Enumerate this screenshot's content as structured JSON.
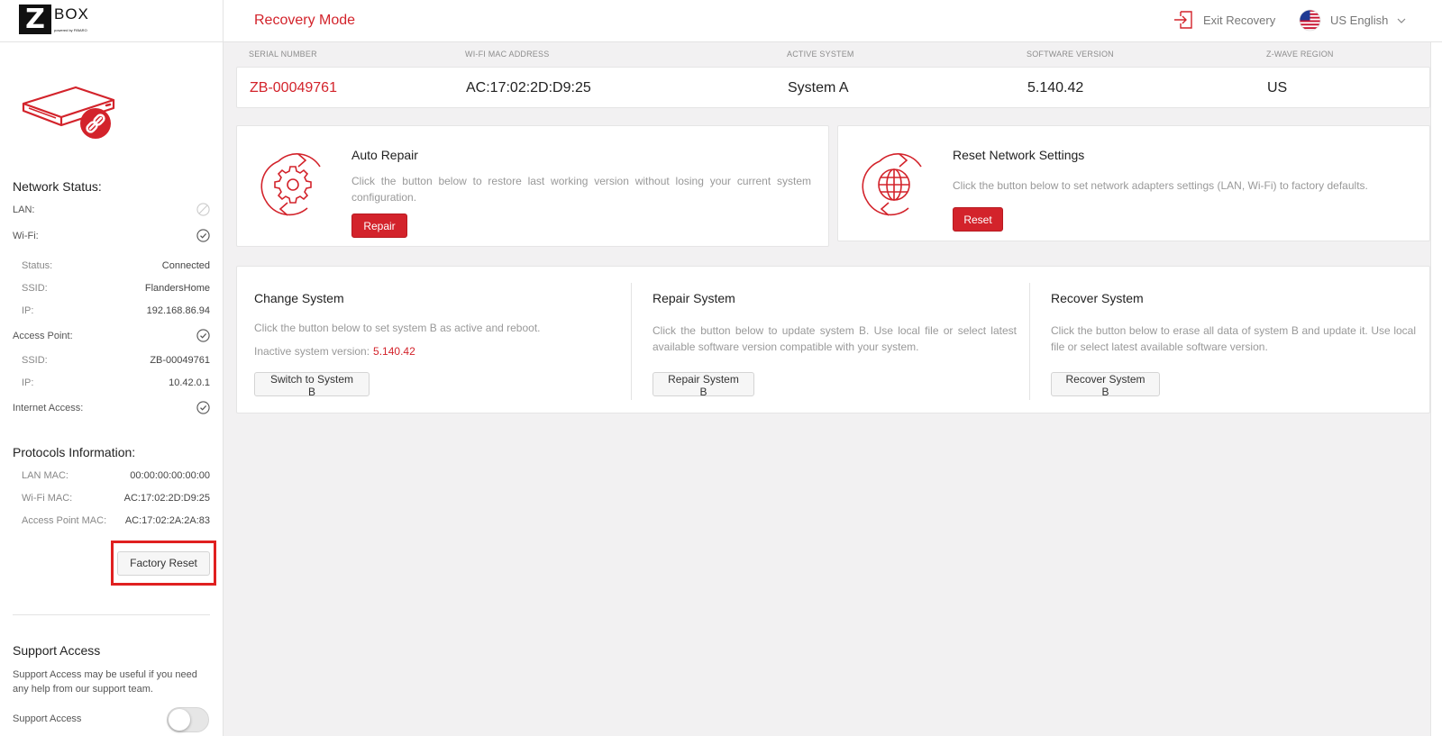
{
  "app": {
    "logo_box": "BOX",
    "logo_sub": "powered by FIBARO",
    "title": "Recovery Mode"
  },
  "header": {
    "exit_label": "Exit Recovery",
    "language": "US English"
  },
  "info": {
    "headers": {
      "serial": "SERIAL NUMBER",
      "mac": "WI-FI MAC ADDRESS",
      "active": "ACTIVE SYSTEM",
      "version": "SOFTWARE VERSION",
      "region": "Z-WAVE REGION"
    },
    "values": {
      "serial": "ZB-00049761",
      "mac": "AC:17:02:2D:D9:25",
      "active": "System A",
      "version": "5.140.42",
      "region": "US"
    }
  },
  "sidebar": {
    "network_title": "Network Status:",
    "lan": {
      "label": "LAN:"
    },
    "wifi": {
      "label": "Wi-Fi:"
    },
    "wifi_status": {
      "label": "Status:",
      "value": "Connected"
    },
    "wifi_ssid": {
      "label": "SSID:",
      "value": "FlandersHome"
    },
    "wifi_ip": {
      "label": "IP:",
      "value": "192.168.86.94"
    },
    "ap": {
      "label": "Access Point:"
    },
    "ap_ssid": {
      "label": "SSID:",
      "value": "ZB-00049761"
    },
    "ap_ip": {
      "label": "IP:",
      "value": "10.42.0.1"
    },
    "internet": {
      "label": "Internet Access:"
    },
    "protocols_title": "Protocols Information:",
    "lan_mac": {
      "label": "LAN MAC:",
      "value": "00:00:00:00:00:00"
    },
    "wifi_mac": {
      "label": "Wi-Fi MAC:",
      "value": "AC:17:02:2D:D9:25"
    },
    "ap_mac": {
      "label": "Access Point MAC:",
      "value": "AC:17:02:2A:2A:83"
    },
    "factory_reset": "Factory Reset",
    "support_title": "Support Access",
    "support_desc": "Support Access may be useful if you need any help from our support team.",
    "support_toggle_label": "Support Access"
  },
  "cards": {
    "auto_repair": {
      "title": "Auto Repair",
      "desc": "Click the button below to restore last working version without losing your current system configuration.",
      "button": "Repair"
    },
    "reset_network": {
      "title": "Reset Network Settings",
      "desc": "Click the button below to set network adapters settings (LAN, Wi-Fi) to factory defaults.",
      "button": "Reset"
    },
    "change_system": {
      "title": "Change System",
      "desc": "Click the button below to set system B as active and reboot.",
      "inactive_label": "Inactive system version:",
      "inactive_value": "5.140.42",
      "button": "Switch to System B"
    },
    "repair_system": {
      "title": "Repair System",
      "desc": "Click the button below to update system B. Use local file or select latest available software version compatible with your system.",
      "button": "Repair System B"
    },
    "recover_system": {
      "title": "Recover System",
      "desc": "Click the button below to erase all data of system B and update it. Use local file or select latest available software version.",
      "button": "Recover System B"
    }
  },
  "colors": {
    "accent": "#d3232b",
    "background": "#f2f1f2"
  }
}
